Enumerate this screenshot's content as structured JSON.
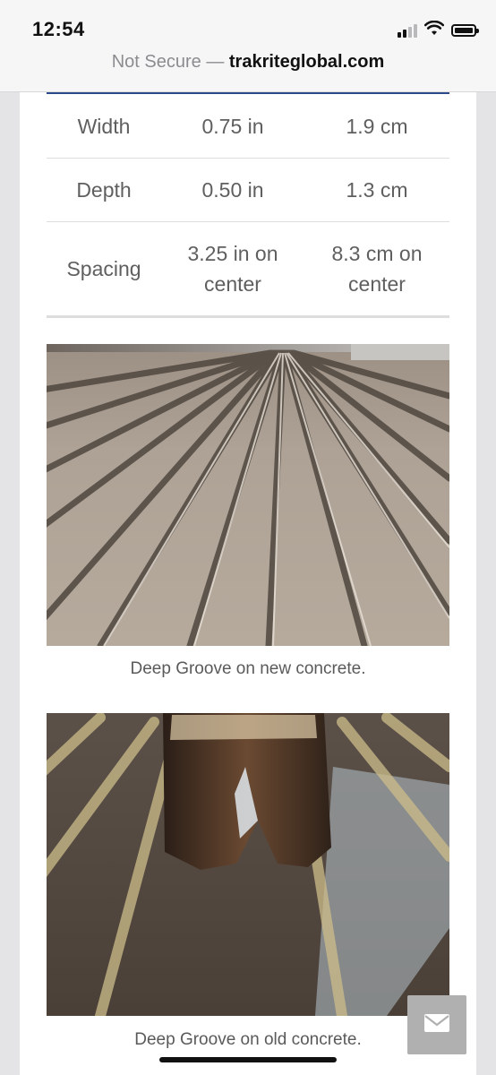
{
  "status_bar": {
    "time": "12:54",
    "icons": [
      "cellular-signal-icon",
      "wifi-icon",
      "battery-icon"
    ]
  },
  "address_bar": {
    "security_label": "Not Secure",
    "separator": "—",
    "domain": "trakriteglobal.com"
  },
  "spec_table": {
    "rows": [
      {
        "label": "Width",
        "imperial": "0.75 in",
        "metric": "1.9 cm"
      },
      {
        "label": "Depth",
        "imperial": "0.50 in",
        "metric": "1.3 cm"
      },
      {
        "label": "Spacing",
        "imperial": "3.25 in on center",
        "metric": "8.3 cm on center"
      }
    ]
  },
  "figures": [
    {
      "caption": "Deep Groove on new concrete."
    },
    {
      "caption": "Deep Groove on old concrete."
    }
  ],
  "floating_button": {
    "icon": "mail-icon"
  },
  "colors": {
    "accent": "#2b4a8b",
    "table_text": "#5f5f5f",
    "floating_button": "#b0b0b0"
  }
}
